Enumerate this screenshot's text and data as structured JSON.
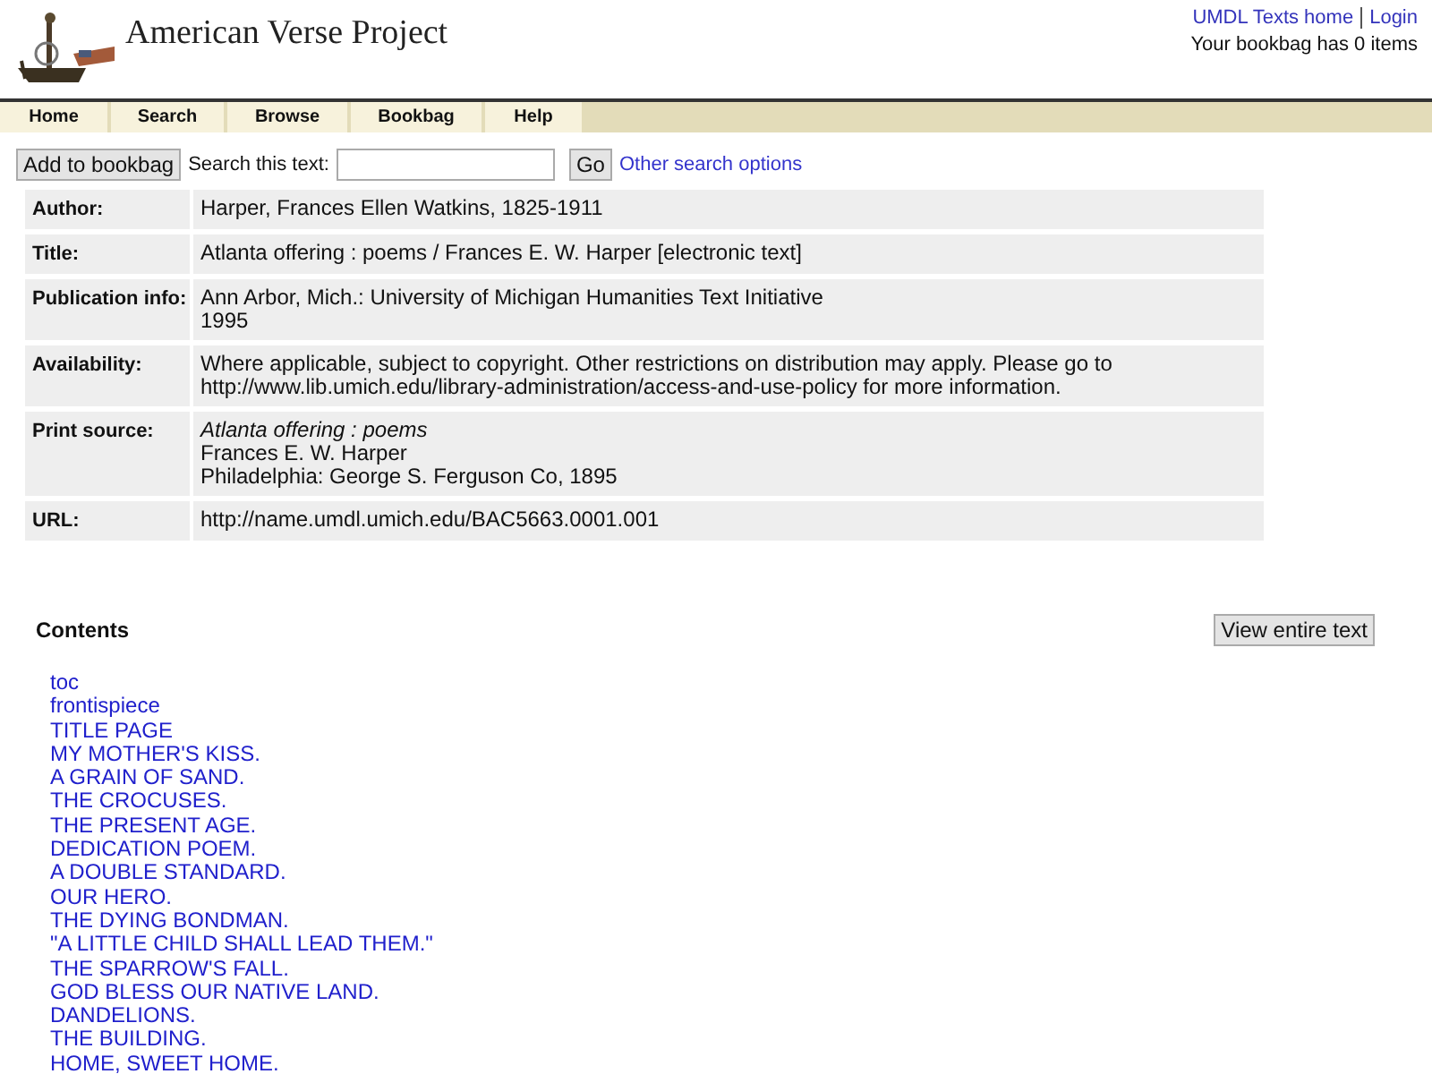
{
  "header": {
    "title": "American Verse Project",
    "links": [
      "UMDL Texts home",
      "Login"
    ],
    "bookbag_status": "Your bookbag has 0 items"
  },
  "nav": [
    "Home",
    "Search",
    "Browse",
    "Bookbag",
    "Help"
  ],
  "toolbar": {
    "add_button": "Add to bookbag",
    "search_label": "Search this text:",
    "go_button": "Go",
    "options_link": "Other search options"
  },
  "record": [
    {
      "label": "Author:",
      "lines": [
        {
          "text": "Harper, Frances Ellen Watkins, 1825-1911",
          "italic": false
        }
      ]
    },
    {
      "label": "Title:",
      "lines": [
        {
          "text": "Atlanta offering : poems / Frances E. W. Harper [electronic text]",
          "italic": false
        }
      ]
    },
    {
      "label": "Publication info:",
      "lines": [
        {
          "text": "Ann Arbor, Mich.: University of Michigan Humanities Text Initiative",
          "italic": false
        },
        {
          "text": "1995",
          "italic": false
        }
      ]
    },
    {
      "label": "Availability:",
      "lines": [
        {
          "text": "Where applicable, subject to copyright. Other restrictions on distribution may apply. Please go to",
          "italic": false
        },
        {
          "text": "http://www.lib.umich.edu/library-administration/access-and-use-policy for more information.",
          "italic": false
        }
      ]
    },
    {
      "label": "Print source:",
      "lines": [
        {
          "text": "Atlanta offering : poems",
          "italic": true
        },
        {
          "text": "Frances E. W. Harper",
          "italic": false
        },
        {
          "text": "Philadelphia: George S. Ferguson Co, 1895",
          "italic": false
        }
      ]
    },
    {
      "label": "URL:",
      "lines": [
        {
          "text": "http://name.umdl.umich.edu/BAC5663.0001.001",
          "italic": false
        }
      ]
    }
  ],
  "contents": {
    "heading": "Contents",
    "view_button": "View entire text",
    "items": [
      "toc",
      "frontispiece",
      "TITLE PAGE",
      "MY MOTHER'S KISS.",
      "A GRAIN OF SAND.",
      "THE CROCUSES.",
      "THE PRESENT AGE.",
      "DEDICATION POEM.",
      "A DOUBLE STANDARD.",
      "OUR HERO.",
      "THE DYING BONDMAN.",
      "\"A LITTLE CHILD SHALL LEAD THEM.\"",
      "THE SPARROW'S FALL.",
      "GOD BLESS OUR NATIVE LAND.",
      "DANDELIONS.",
      "THE BUILDING.",
      "HOME, SWEET HOME."
    ]
  }
}
